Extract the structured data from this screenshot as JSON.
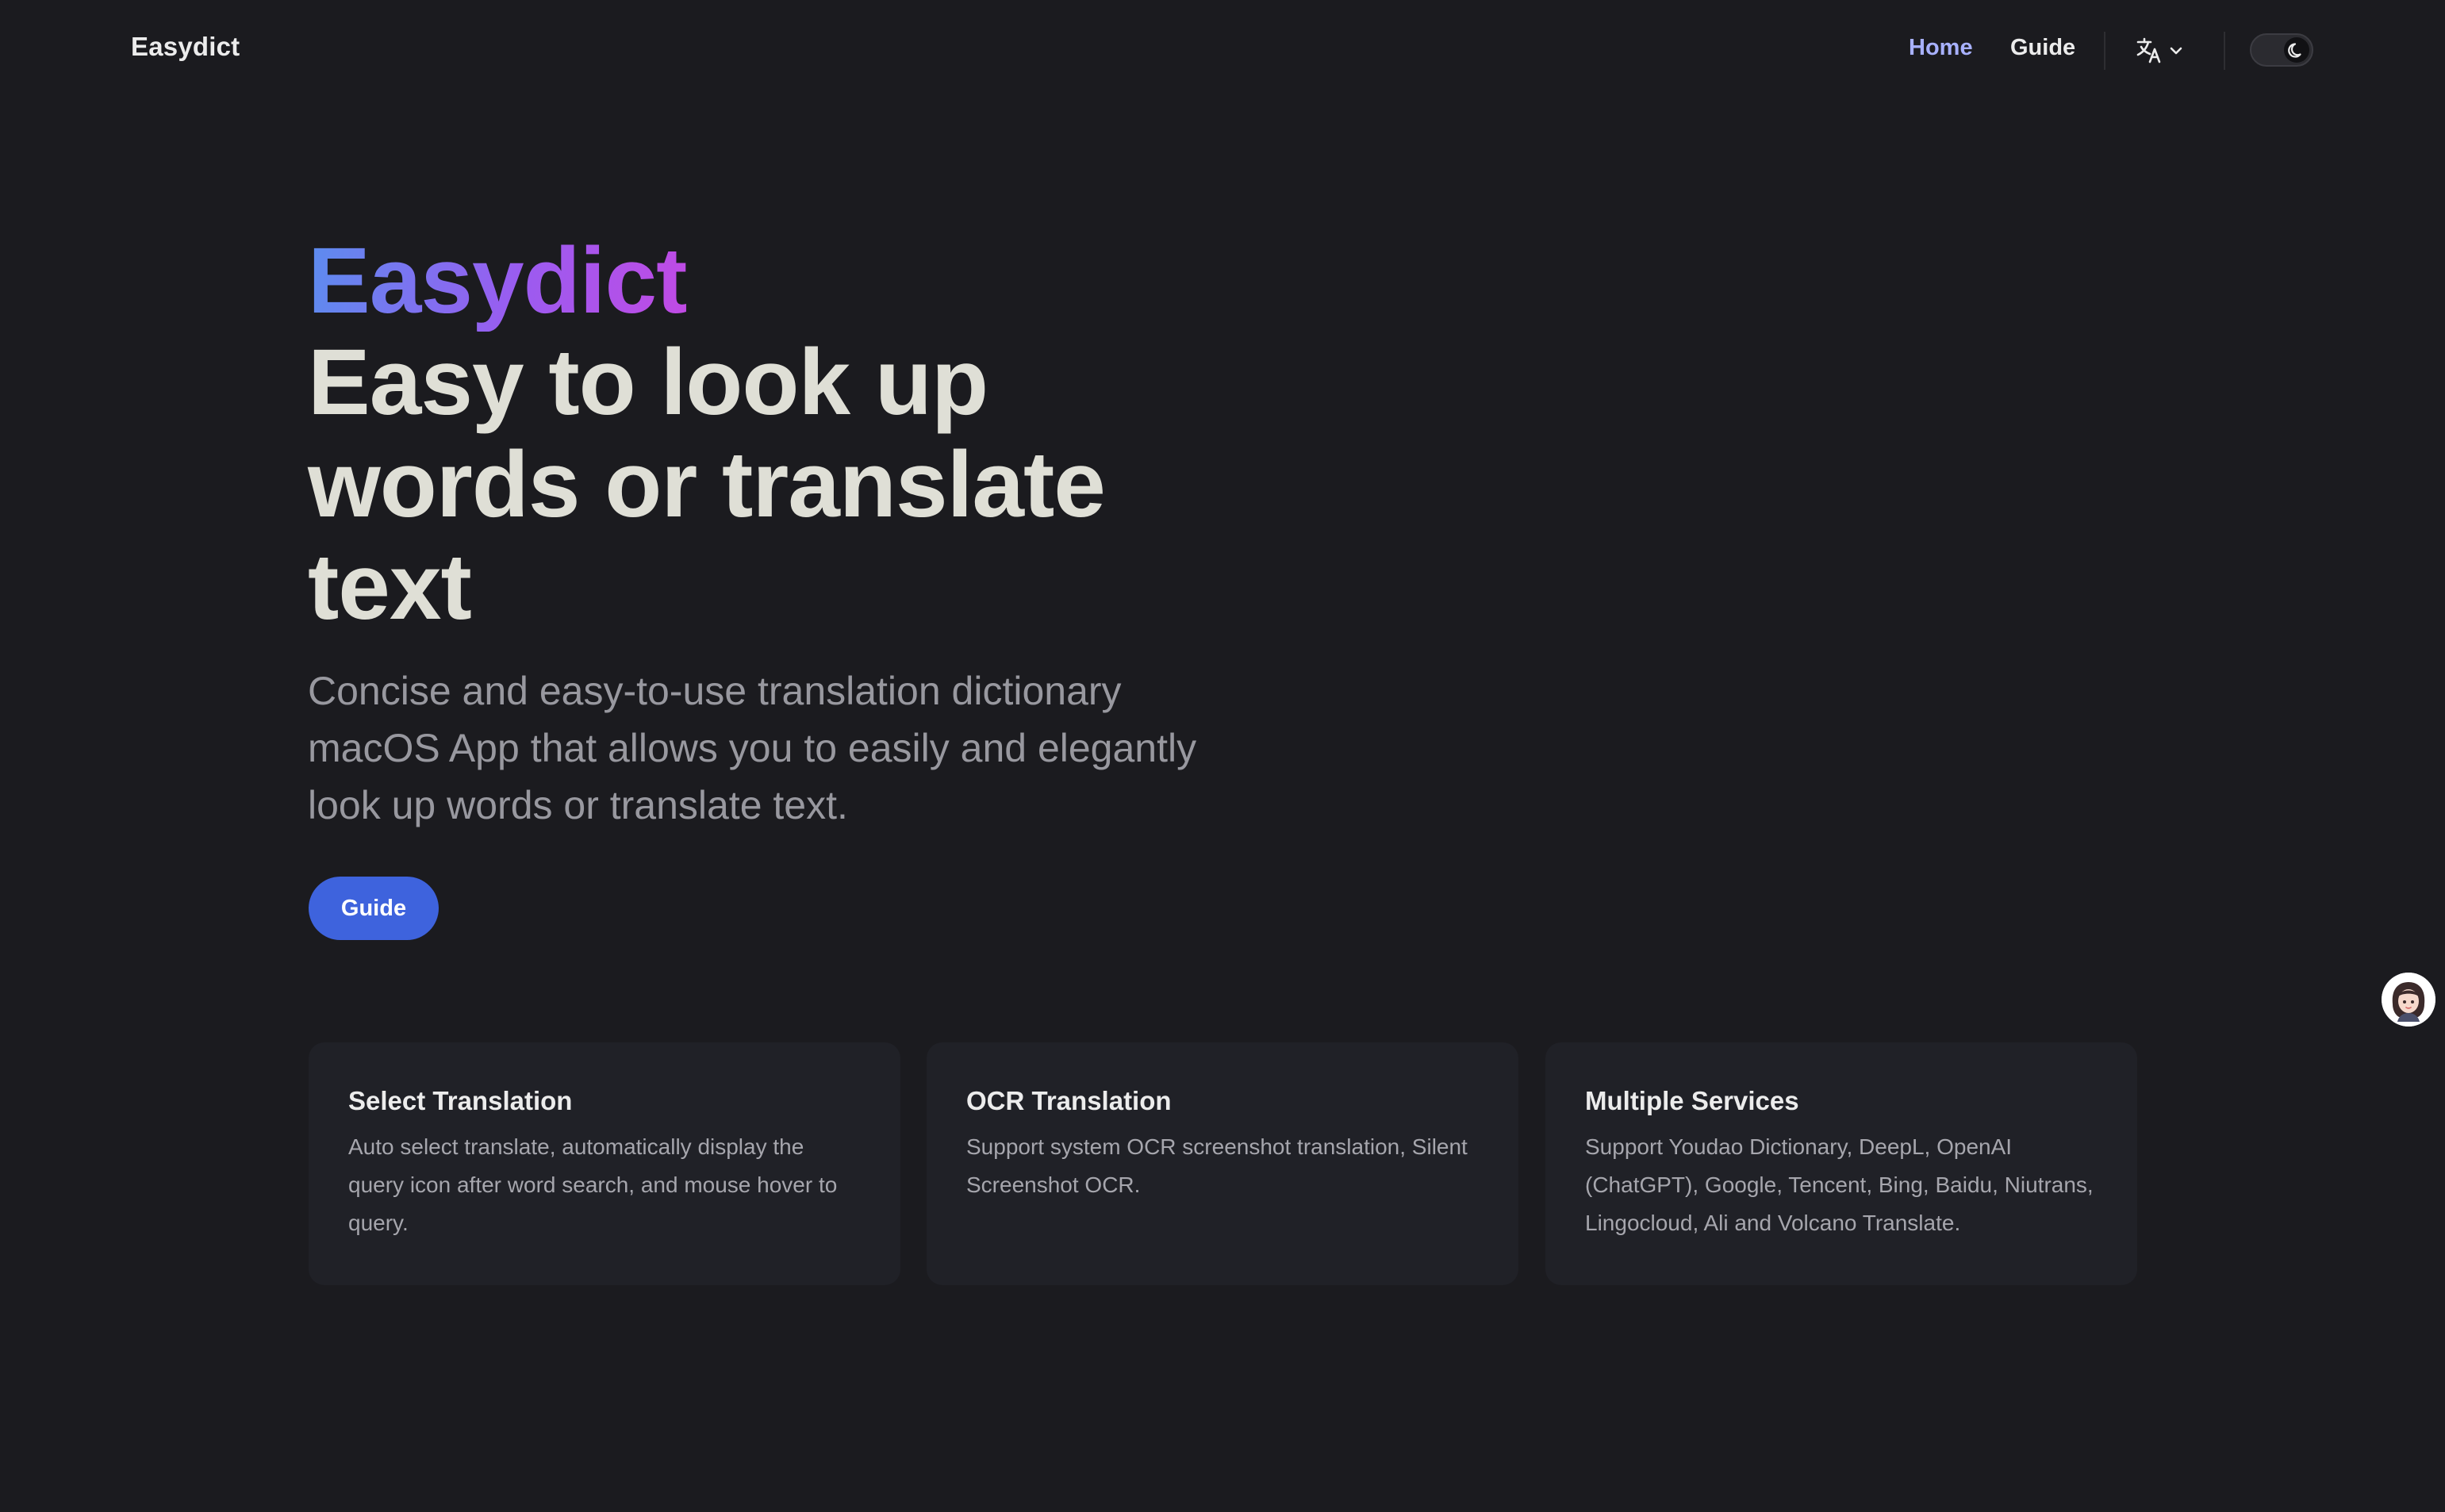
{
  "nav": {
    "brand": "Easydict",
    "links": [
      {
        "label": "Home",
        "active": true
      },
      {
        "label": "Guide",
        "active": false
      }
    ],
    "language_icon": "translate-icon",
    "theme_icon": "moon-icon"
  },
  "hero": {
    "name": "Easydict",
    "title": "Easy to look up words or translate text",
    "tagline": "Concise and easy-to-use translation dictionary macOS App that allows you to easily and elegantly look up words or translate text.",
    "cta_label": "Guide"
  },
  "features": [
    {
      "title": "Select Translation",
      "description": "Auto select translate, automatically display the query icon after word search, and mouse hover to query."
    },
    {
      "title": "OCR Translation",
      "description": "Support system OCR screenshot translation, Silent Screenshot OCR."
    },
    {
      "title": "Multiple Services",
      "description": "Support Youdao Dictionary, DeepL, OpenAI (ChatGPT), Google, Tencent, Bing, Baidu, Niutrans, Lingocloud, Ali and Volcano Translate."
    }
  ],
  "colors": {
    "background": "#1b1b1f",
    "card": "#202127",
    "accent": "#3e63dd",
    "active_link": "#a8b1ff",
    "text": "#dfdfd6",
    "muted": "#98989f"
  }
}
